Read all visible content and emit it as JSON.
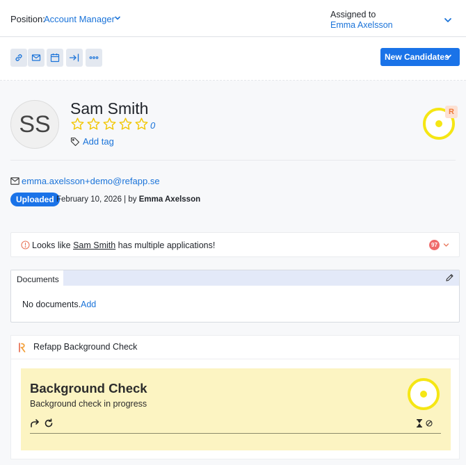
{
  "header": {
    "position_label": "Position:",
    "position_value": "Account Manager",
    "assigned_label": "Assigned to",
    "assigned_value": "Emma Axelsson"
  },
  "toolbar": {
    "icons": [
      "link-icon",
      "mail-icon",
      "calendar-icon",
      "move-to-icon",
      "more-icon"
    ],
    "new_candidates_label": "New Candidates"
  },
  "candidate": {
    "initials": "SS",
    "name": "Sam Smith",
    "rating": "0",
    "rating_stars_filled": 0,
    "rating_stars_total": 5,
    "add_tag_label": "Add tag",
    "email": "emma.axelsson+demo@refapp.se",
    "status_badge": "Uploaded",
    "upload_date": "February 10, 2026",
    "upload_separator": " | by ",
    "uploaded_by": "Emma Axelsson"
  },
  "duplicate_notice": {
    "prefix": "Looks like ",
    "name": "Sam Smith",
    "suffix": " has multiple applications!",
    "count": "97"
  },
  "documents": {
    "tab_label": "Documents",
    "empty_text": "No documents.",
    "add_label": "Add"
  },
  "background_check": {
    "card_title": "Refapp Background Check",
    "heading": "Background Check",
    "status": "Background check in progress"
  },
  "colors": {
    "accent": "#1a73e8",
    "link": "#1a73d9",
    "ring_yellow": "#f5e614",
    "panel_yellow": "#fcf4c2",
    "star": "#f2c600",
    "alert_badge": "#ef6a6a"
  }
}
